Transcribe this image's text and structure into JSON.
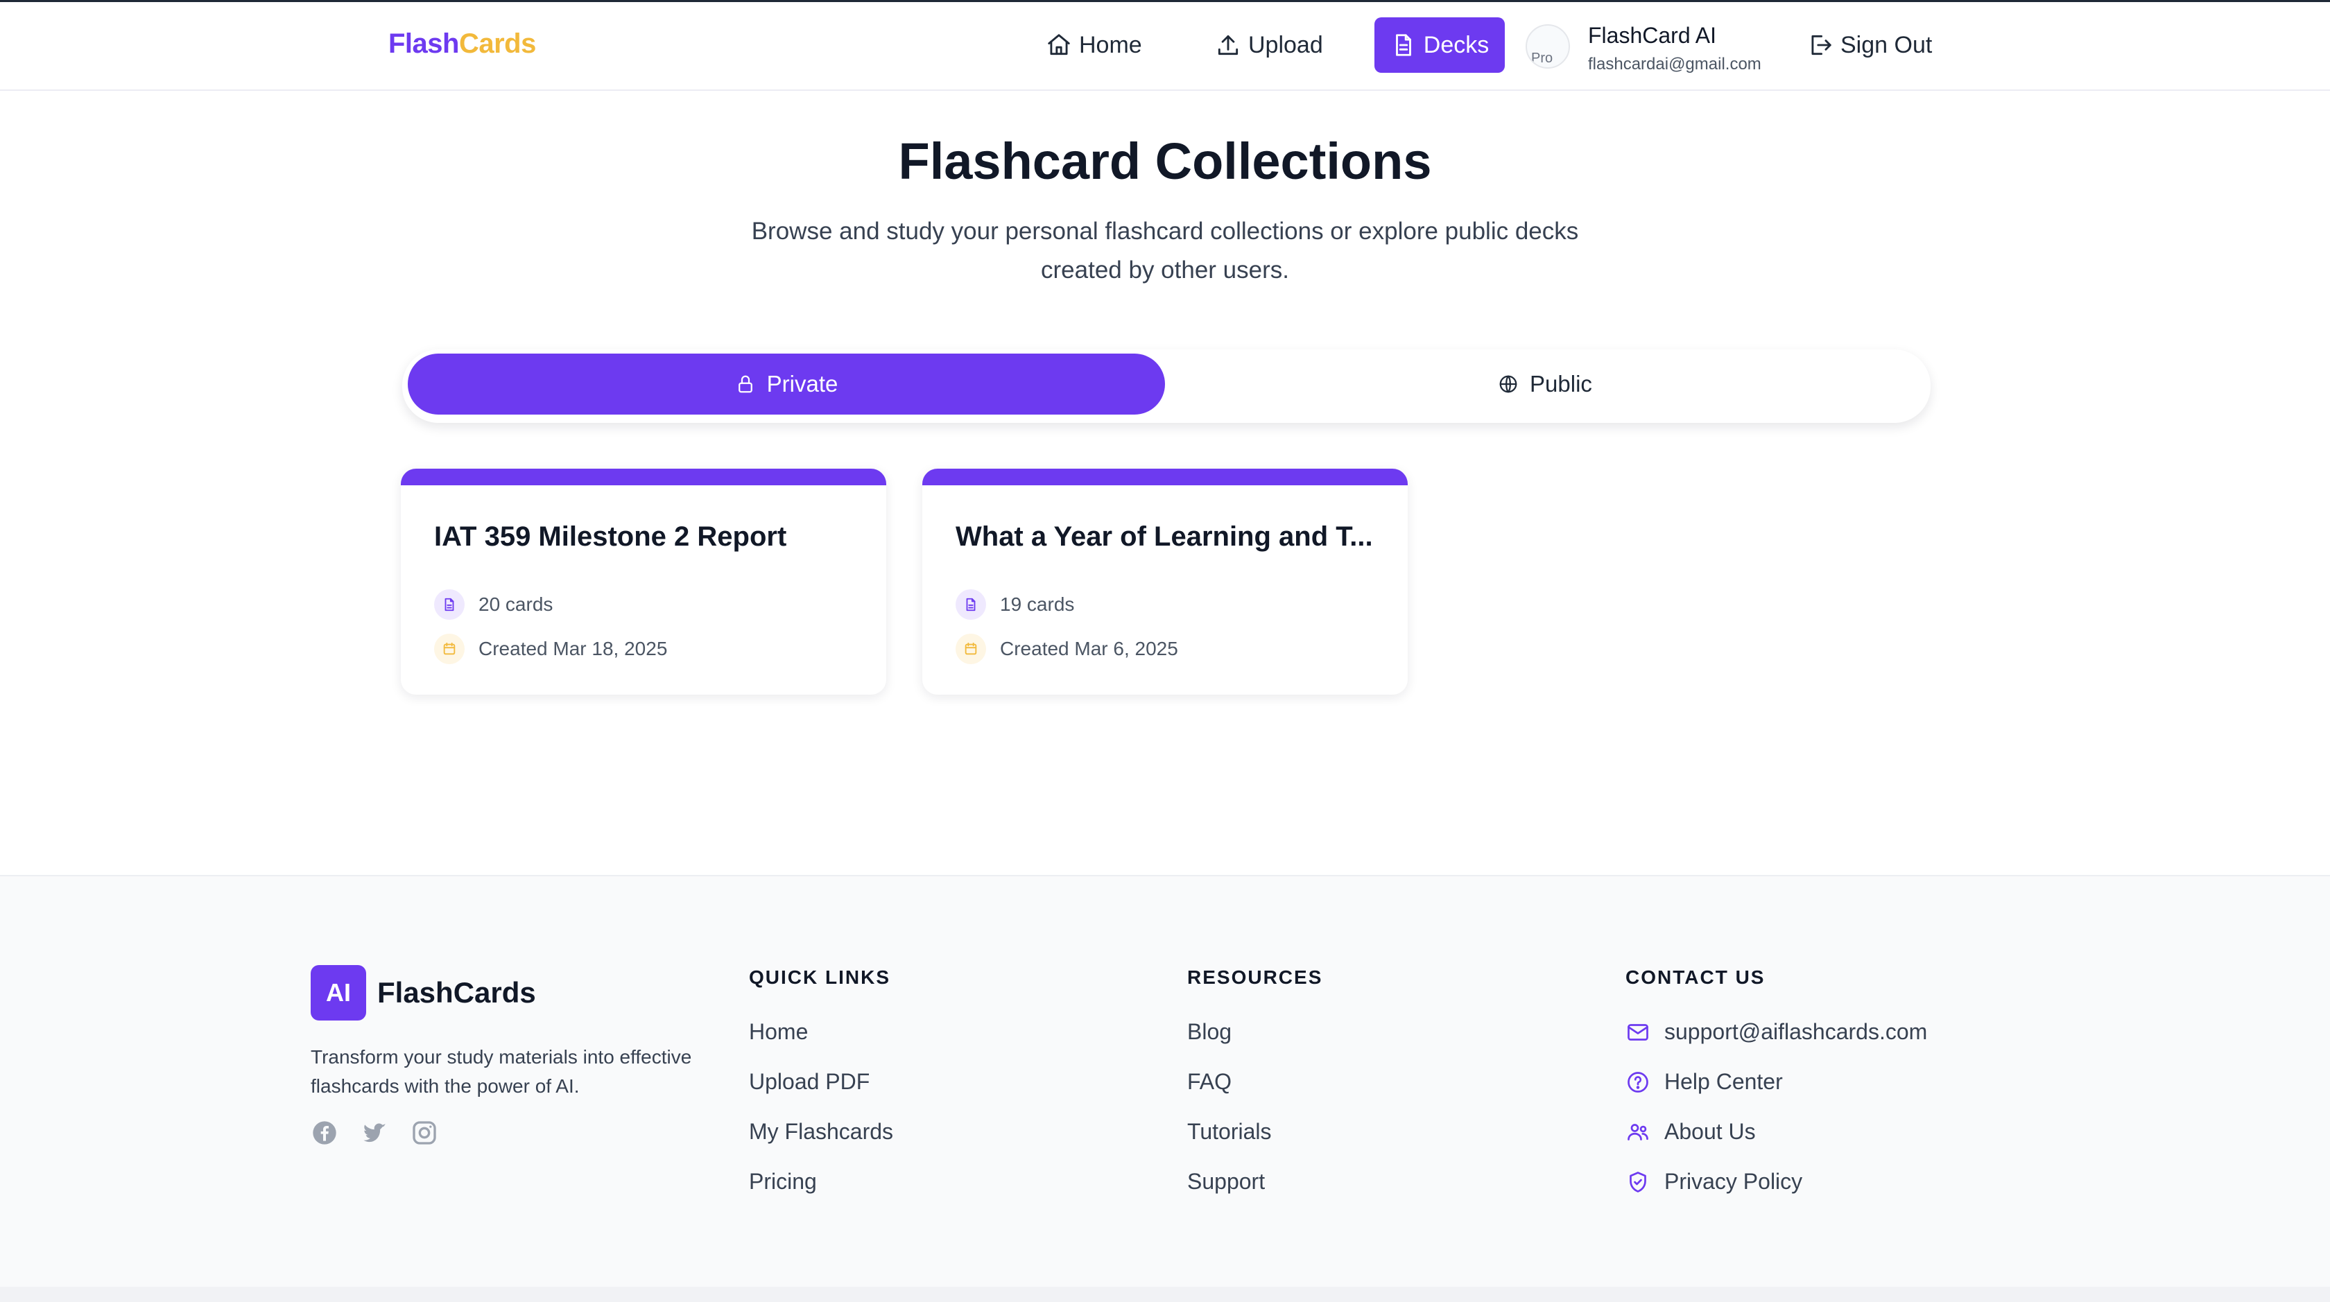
{
  "header": {
    "logo_part1": "Flash",
    "logo_part2": "Cards",
    "nav": {
      "home": "Home",
      "upload": "Upload",
      "decks": "Decks",
      "sign_out": "Sign Out"
    },
    "user": {
      "name": "FlashCard AI",
      "email": "flashcardai@gmail.com",
      "avatar_alt": "Pro"
    }
  },
  "hero": {
    "title": "Flashcard Collections",
    "subtitle": "Browse and study your personal flashcard collections or explore public decks created by other users."
  },
  "tabs": {
    "private": "Private",
    "public": "Public",
    "active": "private"
  },
  "decks": [
    {
      "title": "IAT 359 Milestone 2 Report",
      "cards": "20 cards",
      "created": "Created Mar 18, 2025"
    },
    {
      "title": "What a Year of Learning and T...",
      "cards": "19 cards",
      "created": "Created Mar 6, 2025"
    }
  ],
  "footer": {
    "logo_badge": "AI",
    "logo_text": "FlashCards",
    "tagline": "Transform your study materials into effective flashcards with the power of AI.",
    "quick_links": {
      "title": "QUICK LINKS",
      "items": [
        "Home",
        "Upload PDF",
        "My Flashcards",
        "Pricing"
      ]
    },
    "resources": {
      "title": "RESOURCES",
      "items": [
        "Blog",
        "FAQ",
        "Tutorials",
        "Support"
      ]
    },
    "contact": {
      "title": "CONTACT US",
      "items": [
        "support@aiflashcards.com",
        "Help Center",
        "About Us",
        "Privacy Policy"
      ]
    }
  },
  "colors": {
    "primary": "#6d3af0",
    "accent_yellow": "#f2b93b",
    "text_dark": "#111827",
    "text_muted": "#4b5563"
  },
  "icons": {
    "nav": [
      "home-icon",
      "upload-icon",
      "document-icon",
      "sign-out-icon"
    ],
    "tabs": [
      "lock-icon",
      "globe-icon"
    ],
    "social": [
      "facebook-icon",
      "twitter-icon",
      "instagram-icon"
    ],
    "contact": [
      "mail-icon",
      "help-circle-icon",
      "users-icon",
      "shield-check-icon"
    ]
  }
}
